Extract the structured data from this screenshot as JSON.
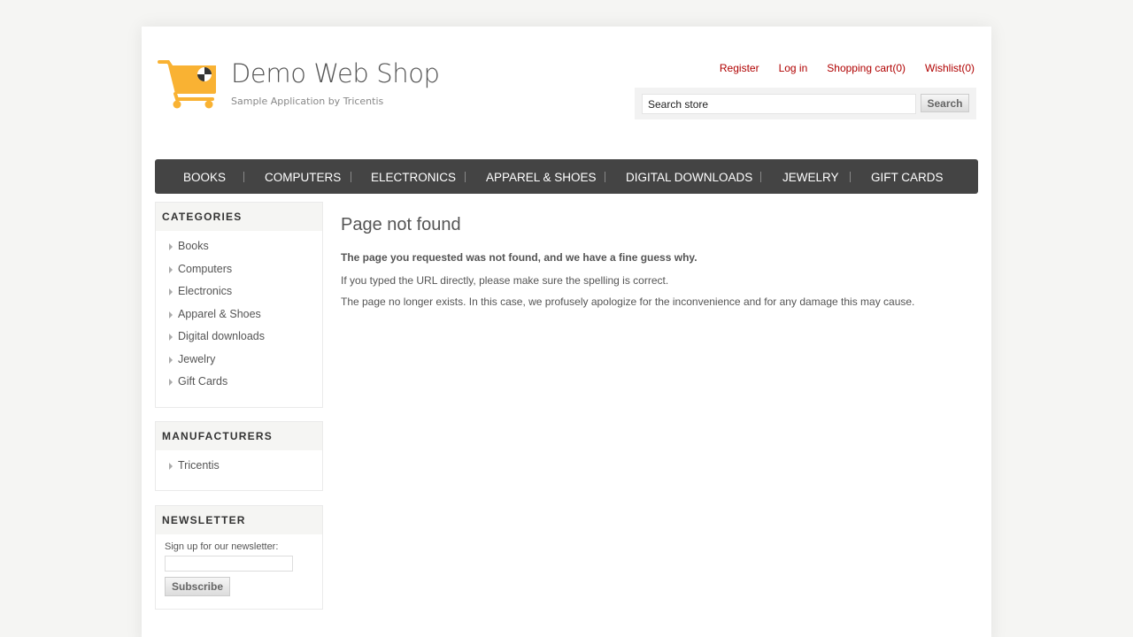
{
  "logo": {
    "title": "Demo Web Shop",
    "subtitle": "Sample Application by Tricentis",
    "icon": "shopping-cart-icon",
    "color": "#f9b233"
  },
  "header_links": {
    "register": "Register",
    "login": "Log in",
    "cart": "Shopping cart(0)",
    "wishlist": "Wishlist(0)",
    "color": "#b00000"
  },
  "search": {
    "value": "Search store",
    "button": "Search"
  },
  "top_menu": [
    "BOOKS",
    "COMPUTERS",
    "ELECTRONICS",
    "APPAREL & SHOES",
    "DIGITAL DOWNLOADS",
    "JEWELRY",
    "GIFT CARDS"
  ],
  "categories": {
    "title": "CATEGORIES",
    "items": [
      "Books",
      "Computers",
      "Electronics",
      "Apparel & Shoes",
      "Digital downloads",
      "Jewelry",
      "Gift Cards"
    ]
  },
  "manufacturers": {
    "title": "MANUFACTURERS",
    "items": [
      "Tricentis"
    ]
  },
  "newsletter": {
    "title": "NEWSLETTER",
    "label": "Sign up for our newsletter:",
    "button": "Subscribe"
  },
  "main": {
    "title": "Page not found",
    "bold": "The page you requested was not found, and we have a fine guess why.",
    "p1": "If you typed the URL directly, please make sure the spelling is correct.",
    "p2": "The page no longer exists. In this case, we profusely apologize for the inconvenience and for any damage this may cause."
  }
}
